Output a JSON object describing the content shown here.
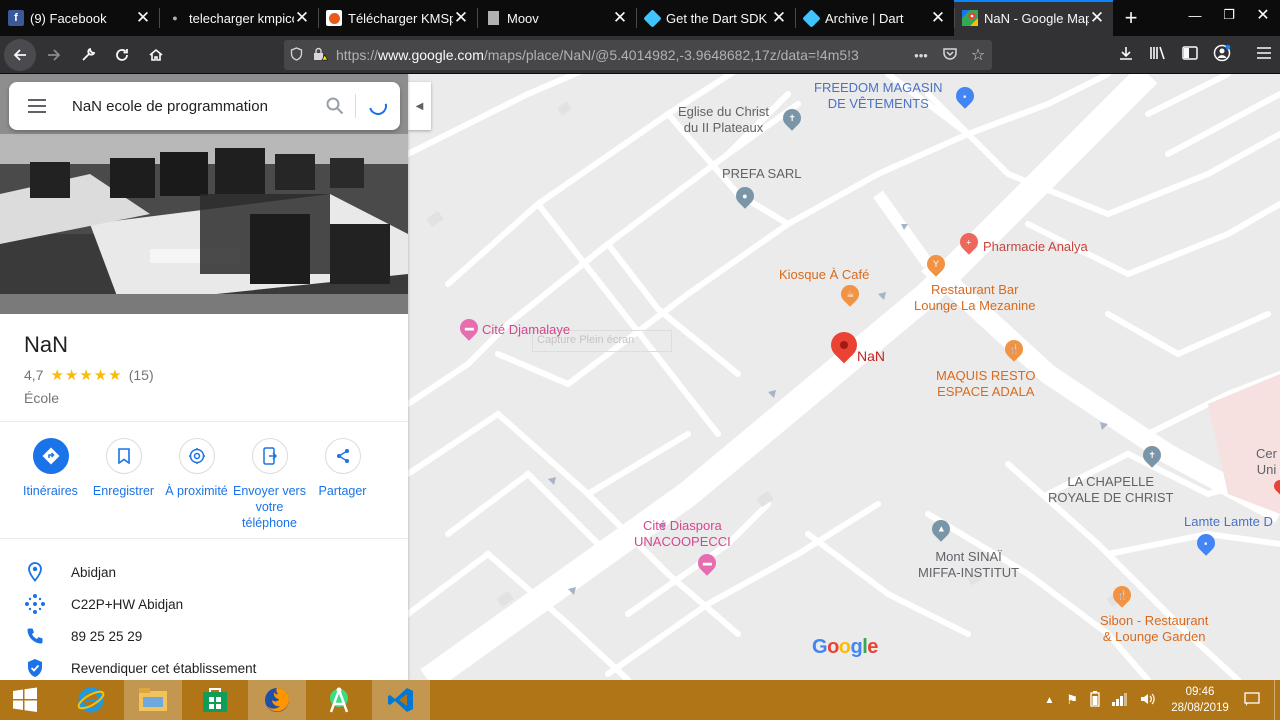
{
  "browser": {
    "tabs": [
      {
        "title": "(9) Facebook",
        "favicon": "facebook-icon",
        "color": "#3b5998"
      },
      {
        "title": "telecharger kmpico",
        "favicon": "dot-icon",
        "color": "#888888"
      },
      {
        "title": "Télécharger KMSpi",
        "favicon": "kmspico-icon",
        "color": "#e8591a"
      },
      {
        "title": "Moov",
        "favicon": "page-icon",
        "color": "#d7d7db"
      },
      {
        "title": "Get the Dart SDK |",
        "favicon": "dart-icon",
        "color": "#0175c2"
      },
      {
        "title": "Archive | Dart",
        "favicon": "dart-icon",
        "color": "#0175c2"
      },
      {
        "title": "NaN - Google Map",
        "favicon": "google-maps-icon",
        "color": "#34a853",
        "active": true
      }
    ],
    "new_tab": "+",
    "url": "https://www.google.com/maps/place/NaN/@5.4014982,-3.9648682,17z/data=!4m5!3",
    "url_host": "www.google.com"
  },
  "search": {
    "value": "NaN ecole de programmation"
  },
  "place": {
    "name": "NaN",
    "rating": "4,7",
    "stars": "★★★★★",
    "reviews": "(15)",
    "category": "École"
  },
  "actions": [
    {
      "label": "Itinéraires",
      "icon": "directions-icon"
    },
    {
      "label": "Enregistrer",
      "icon": "bookmark-icon"
    },
    {
      "label": "À proximité",
      "icon": "nearby-icon"
    },
    {
      "label": "Envoyer vers votre téléphone",
      "icon": "send-to-phone-icon"
    },
    {
      "label": "Partager",
      "icon": "share-icon"
    }
  ],
  "info": [
    {
      "text": "Abidjan",
      "icon": "location-pin-icon"
    },
    {
      "text": "C22P+HW Abidjan",
      "icon": "plus-code-icon"
    },
    {
      "text": "89 25 25 29",
      "icon": "phone-icon"
    },
    {
      "text": "Revendiquer cet établissement",
      "icon": "verified-shield-icon"
    }
  ],
  "map": {
    "pois": [
      {
        "label": "FREEDOM MAGASIN DE VÊTEMENTS",
        "l1": "FREEDOM MAGASIN",
        "l2": "DE VÊTEMENTS"
      },
      {
        "label": "Eglise du Christ du II Plateaux",
        "l1": "Eglise du Christ",
        "l2": "du II Plateaux"
      },
      {
        "label": "PREFA SARL"
      },
      {
        "label": "Pharmacie Analya"
      },
      {
        "label": "Kiosque À Café"
      },
      {
        "label": "Restaurant Bar Lounge La Mezanine",
        "l1": "Restaurant Bar",
        "l2": "Lounge La Mezanine"
      },
      {
        "label": "Cité Djamalaye"
      },
      {
        "label": "NaN"
      },
      {
        "label": "MAQUIS RESTO ESPACE ADALA",
        "l1": "MAQUIS RESTO",
        "l2": "ESPACE ADALA"
      },
      {
        "label": "LA CHAPELLE ROYALE DE CHRIST",
        "l1": "LA CHAPELLE",
        "l2": "ROYALE DE CHRIST"
      },
      {
        "label": "Lamte Lamte D",
        "l1": "Lamte Lamte D"
      },
      {
        "label": "Cité Diaspora UNACOOPECCI",
        "l1": "Cité Diaspora",
        "l2": "UNACOOPECCI"
      },
      {
        "label": "Mont SINAÏ MIFFA-INSTITUT",
        "l1": "Mont SINAÏ",
        "l2": "MIFFA-INSTITUT"
      },
      {
        "label": "Sibon - Restaurant & Lounge Garden",
        "l1": "Sibon - Restaurant",
        "l2": "& Lounge Garden"
      },
      {
        "label": "Cer Uni",
        "l1": "Cer",
        "l2": "Uni"
      }
    ],
    "watermark": "Capture Plein écran",
    "logo": "Google"
  },
  "taskbar": {
    "time": "09:46",
    "date": "28/08/2019"
  },
  "colors": {
    "accent": "#1a73e8",
    "taskbar": "#b07516",
    "pin": "#ea4335"
  }
}
